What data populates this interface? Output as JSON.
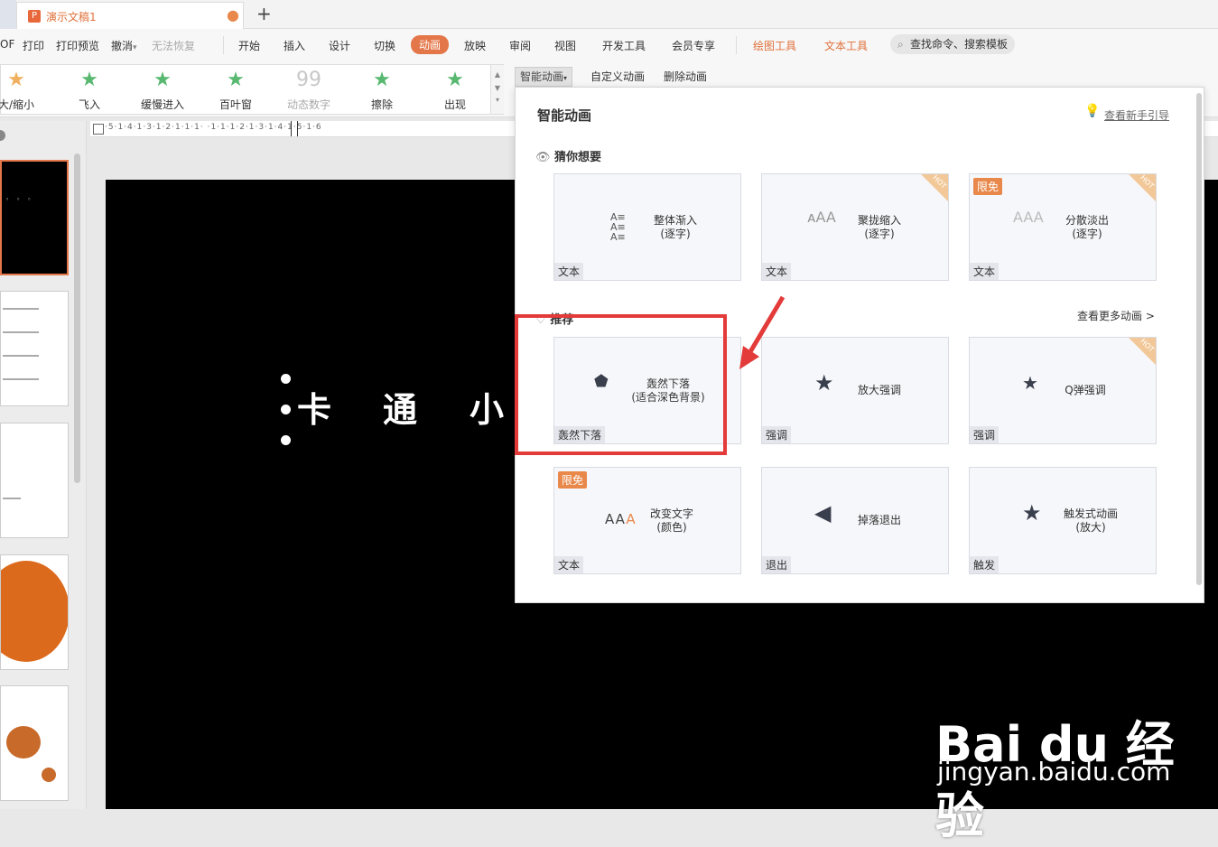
{
  "tabbar": {
    "doc_icon": "P",
    "doc_title": "演示文稿1",
    "dot": "●",
    "new_tab": "+"
  },
  "menu": {
    "items": [
      "OF",
      "打印",
      "打印预览",
      "撤消",
      "无法恢复",
      "开始",
      "插入",
      "设计",
      "切换",
      "动画",
      "放映",
      "审阅",
      "视图",
      "开发工具",
      "会员专享",
      "绘图工具",
      "文本工具"
    ],
    "dropdown_arrow": "▾",
    "search": "查找命令、搜索模板",
    "search_icon": "magnifier-icon"
  },
  "ribbon": {
    "gallery": [
      "大/缩小",
      "飞入",
      "缓慢进入",
      "百叶窗",
      "动态数字",
      "擦除",
      "出现"
    ],
    "star_icon": "★",
    "dynamic_number_icon": "99",
    "buttons": {
      "smart": "智能动画",
      "custom": "自定义动画",
      "delete": "删除动画"
    }
  },
  "ruler": {
    "text": "·5·1·4·1·3·1·2·1·1·1·    ·1·1·1·2·1·3·1·4·1·5·1·6"
  },
  "slide": {
    "chars": [
      "卡",
      "通",
      "小"
    ]
  },
  "popup": {
    "title": "智能动画",
    "guide": "查看新手引导",
    "guess_section": "猜你想要",
    "recommend_section": "推荐",
    "more": "查看更多动画 >",
    "free_badge": "限免",
    "hot_badge": "HOT",
    "guess_cards": [
      {
        "name": "整体渐入\n(逐字)",
        "tag": "文本"
      },
      {
        "name": "聚拢缩入\n(逐字)",
        "tag": "文本"
      },
      {
        "name": "分散淡出\n(逐字)",
        "tag": "文本"
      }
    ],
    "recommend_cards": [
      {
        "name": "轰然下落\n(适合深色背景)",
        "tag": "轰然下落"
      },
      {
        "name": "放大强调",
        "tag": "强调"
      },
      {
        "name": "Q弹强调",
        "tag": "强调"
      },
      {
        "name": "改变文字\n(颜色)",
        "tag": "文本"
      },
      {
        "name": "掉落退出",
        "tag": "退出"
      },
      {
        "name": "触发式动画\n(放大)",
        "tag": "触发"
      }
    ]
  },
  "watermark": {
    "logo": "Bai du 经验",
    "url": "jingyan.baidu.com"
  },
  "colors": {
    "accent": "#e4774a",
    "highlight": "#e33a3a"
  }
}
